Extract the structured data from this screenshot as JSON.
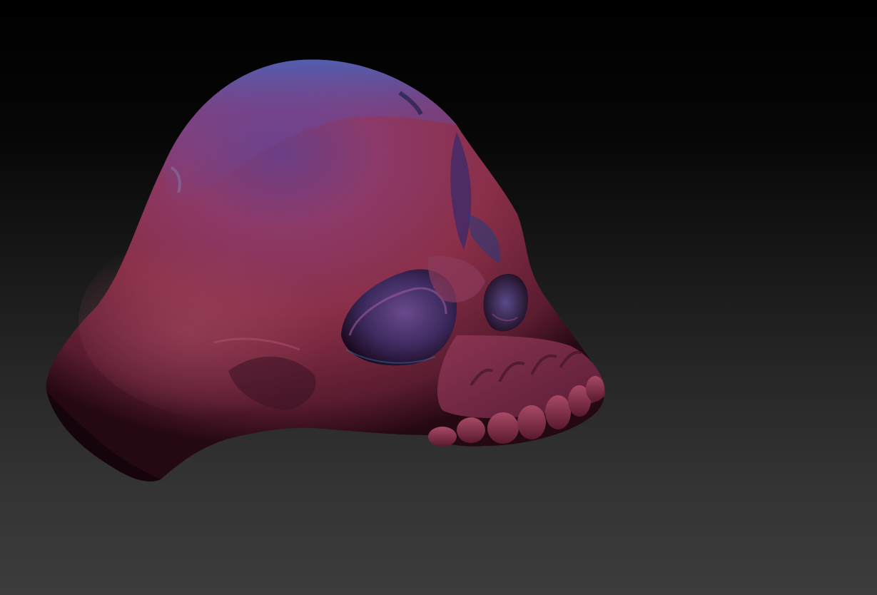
{
  "scene": {
    "subject": "skull-sculpt",
    "background_top_color": "#000000",
    "background_bottom_color": "#3c3c3c",
    "material_colors": {
      "base": "#7a2a3e",
      "highlight": "#b5506e",
      "rim_blue": "#3a4f9a",
      "shadow": "#1a0610"
    }
  }
}
